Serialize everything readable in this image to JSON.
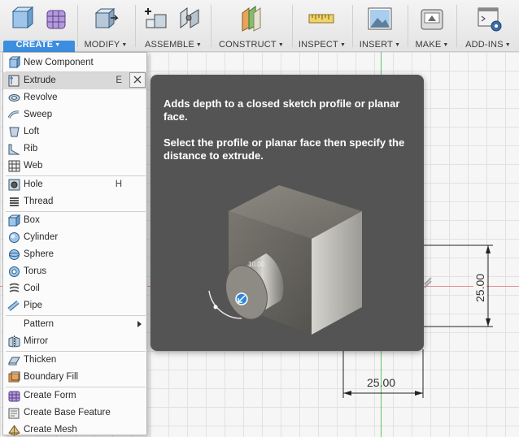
{
  "toolbar": {
    "groups": [
      {
        "label": "CREATE",
        "icons": [
          "new-component-icon",
          "form-icon"
        ]
      },
      {
        "label": "MODIFY",
        "icons": [
          "press-pull-icon"
        ]
      },
      {
        "label": "ASSEMBLE",
        "icons": [
          "new-component-assemble-icon",
          "joint-icon"
        ]
      },
      {
        "label": "CONSTRUCT",
        "icons": [
          "offset-plane-icon"
        ]
      },
      {
        "label": "INSPECT",
        "icons": [
          "measure-icon"
        ]
      },
      {
        "label": "INSERT",
        "icons": [
          "insert-image-icon"
        ]
      },
      {
        "label": "MAKE",
        "icons": [
          "3d-print-icon"
        ]
      },
      {
        "label": "ADD-INS",
        "icons": [
          "scripts-icon"
        ]
      }
    ],
    "active_group": "CREATE",
    "accent_color": "#3d8ee0"
  },
  "create_menu": {
    "items": [
      {
        "label": "New Component",
        "icon": "new-component-icon"
      },
      {
        "label": "Extrude",
        "icon": "extrude-icon",
        "shortcut": "E",
        "hovered": true
      },
      {
        "label": "Revolve",
        "icon": "revolve-icon"
      },
      {
        "label": "Sweep",
        "icon": "sweep-icon"
      },
      {
        "label": "Loft",
        "icon": "loft-icon"
      },
      {
        "label": "Rib",
        "icon": "rib-icon"
      },
      {
        "label": "Web",
        "icon": "web-icon"
      },
      {
        "label": "Hole",
        "icon": "hole-icon",
        "shortcut": "H"
      },
      {
        "label": "Thread",
        "icon": "thread-icon"
      },
      {
        "label": "Box",
        "icon": "box-icon"
      },
      {
        "label": "Cylinder",
        "icon": "cylinder-icon"
      },
      {
        "label": "Sphere",
        "icon": "sphere-icon"
      },
      {
        "label": "Torus",
        "icon": "torus-icon"
      },
      {
        "label": "Coil",
        "icon": "coil-icon"
      },
      {
        "label": "Pipe",
        "icon": "pipe-icon"
      },
      {
        "label": "Pattern",
        "icon": "",
        "has_submenu": true
      },
      {
        "label": "Mirror",
        "icon": "mirror-icon"
      },
      {
        "label": "Thicken",
        "icon": "thicken-icon"
      },
      {
        "label": "Boundary Fill",
        "icon": "boundary-fill-icon"
      },
      {
        "label": "Create Form",
        "icon": "create-form-icon"
      },
      {
        "label": "Create Base Feature",
        "icon": "base-feature-icon"
      },
      {
        "label": "Create Mesh",
        "icon": "create-mesh-icon"
      }
    ]
  },
  "tooltip": {
    "description": "Adds depth to a closed sketch profile or planar face.",
    "instruction": "Select the profile or planar face then specify the distance to extrude.",
    "illustration_value": "10.00"
  },
  "canvas": {
    "dimension_vertical": "25.00",
    "dimension_horizontal": "25.00",
    "x_axis_color": "#e88a8a",
    "y_axis_color": "#5ec45e"
  }
}
